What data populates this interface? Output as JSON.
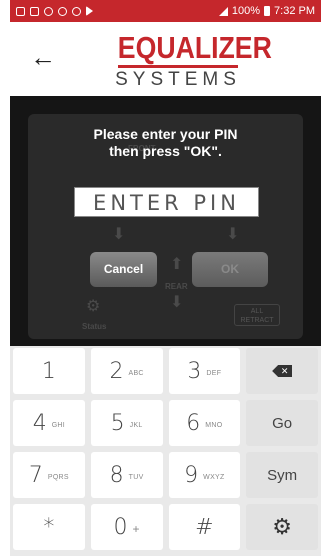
{
  "status_bar": {
    "time": "7:32 PM",
    "battery": "100%"
  },
  "header": {
    "back_icon": "back-arrow-icon",
    "logo_top": "EQUALIZER",
    "logo_bottom": "SYSTEMS"
  },
  "dialog": {
    "prompt_line1": "Please enter your PIN",
    "prompt_line2": "then press \"OK\".",
    "pin_placeholder": "ENTER PIN",
    "cancel_label": "Cancel",
    "ok_label": "OK"
  },
  "background_panel": {
    "front_label": "FRONT",
    "rear_label": "REAR",
    "all_retract_label": "ALL RETRACT",
    "status_label": "Status"
  },
  "keyboard": {
    "keys": [
      {
        "main": "1",
        "sub": ""
      },
      {
        "main": "2",
        "sub": "ABC"
      },
      {
        "main": "3",
        "sub": "DEF"
      },
      {
        "main": "",
        "sub": "",
        "icon": "backspace-icon"
      },
      {
        "main": "4",
        "sub": "GHI"
      },
      {
        "main": "5",
        "sub": "JKL"
      },
      {
        "main": "6",
        "sub": "MNO"
      },
      {
        "main": "Go",
        "sub": ""
      },
      {
        "main": "7",
        "sub": "PQRS"
      },
      {
        "main": "8",
        "sub": "TUV"
      },
      {
        "main": "9",
        "sub": "WXYZ"
      },
      {
        "main": "Sym",
        "sub": ""
      },
      {
        "main": "*",
        "sub": ""
      },
      {
        "main": "0",
        "sub": "+"
      },
      {
        "main": "#",
        "sub": ""
      },
      {
        "main": "",
        "sub": "",
        "icon": "settings-gear-icon"
      }
    ]
  },
  "colors": {
    "brand": "#c5272c",
    "dark": "#1b1b1b"
  }
}
